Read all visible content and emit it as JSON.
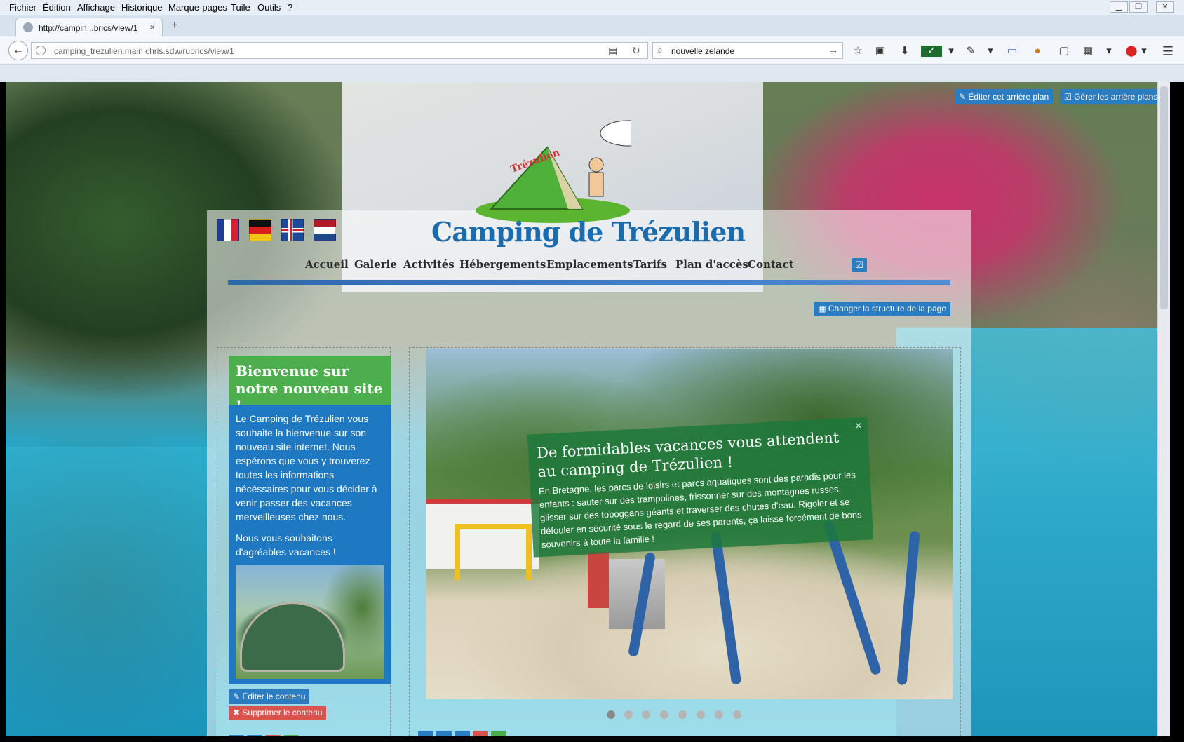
{
  "browser": {
    "menu": [
      "Fichier",
      "Édition",
      "Affichage",
      "Historique",
      "Marque-pages",
      "Tuile",
      "Outils",
      "?"
    ],
    "tab_title": "http://campin...brics/view/1",
    "tab_close": "×",
    "new_tab": "+",
    "url": "camping_trezulien.main.chris.sdw/rubrics/view/1",
    "search_value": "nouvelle zelande"
  },
  "page": {
    "background_buttons": {
      "edit": "Éditer cet arrière plan",
      "manage": "Gérer les arrière plans"
    },
    "site_title": "Camping de Trézulien",
    "flags": [
      "fr",
      "de",
      "is",
      "nl"
    ],
    "nav": [
      "Accueil",
      "Galerie",
      "Activités",
      "Hébergements",
      "Emplacements",
      "Tarifs",
      "Plan d'accès",
      "Contact"
    ],
    "change_structure": "Changer la structure de la page",
    "welcome": {
      "title": "Bienvenue sur notre nouveau site !",
      "paragraph1": "Le Camping de Trézulien vous souhaite la bienvenue sur son nouveau site internet. Nous espérons que vous y trouverez toutes les informations nécéssaires pour vous décider à venir passer des vacances merveilleuses chez nous.",
      "paragraph2": "Nous vous souhaitons d'agréables vacances !"
    },
    "edit_content": "Éditer le contenu",
    "delete_content": "Supprimer le contenu",
    "slider": {
      "caption_title": "De formidables vacances vous attendent au camping de Trézulien !",
      "caption_text": "En Bretagne, les parcs de loisirs et parcs aquatiques sont des paradis pour les enfants : sauter sur des trampolines, frissonner sur des montagnes russes, glisser sur des toboggans géants et traverser des chutes d'eau. Rigoler et se défouler en sécurité sous le regard de ses parents, ça laisse forcément de bons souvenirs à toute la famille !",
      "close": "×",
      "slide_count": 8,
      "active_slide": 1
    }
  },
  "colors": {
    "primary_button": "#2b7cc1",
    "danger_button": "#d9534f",
    "welcome_green": "#4cae4c",
    "welcome_blue": "#1e78c2",
    "title_blue": "#1a6cae"
  }
}
